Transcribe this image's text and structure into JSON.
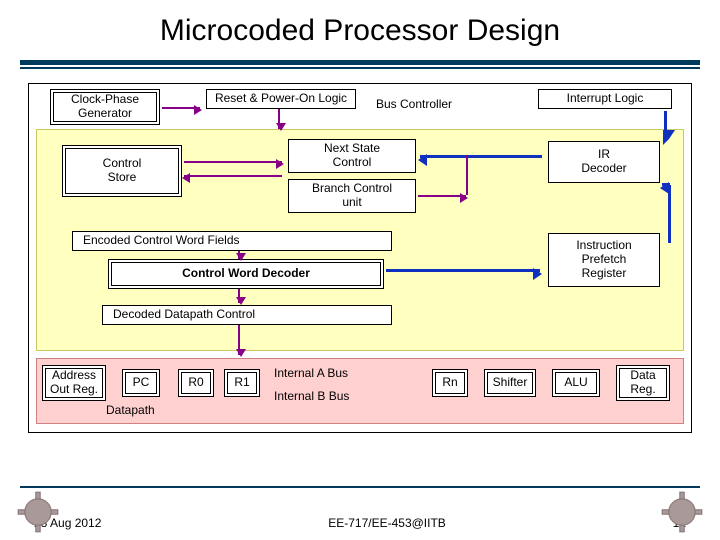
{
  "title": "Microcoded Processor Design",
  "blocks": {
    "clock_phase": "Clock-Phase\nGenerator",
    "reset_power": "Reset & Power-On Logic",
    "bus_controller": "Bus Controller",
    "interrupt_logic": "Interrupt Logic",
    "control_store": "Control\nStore",
    "next_state": "Next State\nControl",
    "branch_control": "Branch Control\nunit",
    "ir_decoder": "IR\nDecoder",
    "encoded_fields": "Encoded Control Word Fields",
    "control_word_decoder": "Control Word Decoder",
    "decoded_datapath": "Decoded Datapath Control",
    "instr_prefetch": "Instruction\nPrefetch\nRegister",
    "addr_out": "Address\nOut Reg.",
    "pc": "PC",
    "r0": "R0",
    "r1": "R1",
    "internal_a": "Internal A Bus",
    "internal_b": "Internal B Bus",
    "rn": "Rn",
    "shifter": "Shifter",
    "alu": "ALU",
    "data_reg": "Data\nReg.",
    "datapath": "Datapath"
  },
  "footer": {
    "date": "28 Aug 2012",
    "center": "EE-717/EE-453@IITB",
    "page": "12"
  }
}
